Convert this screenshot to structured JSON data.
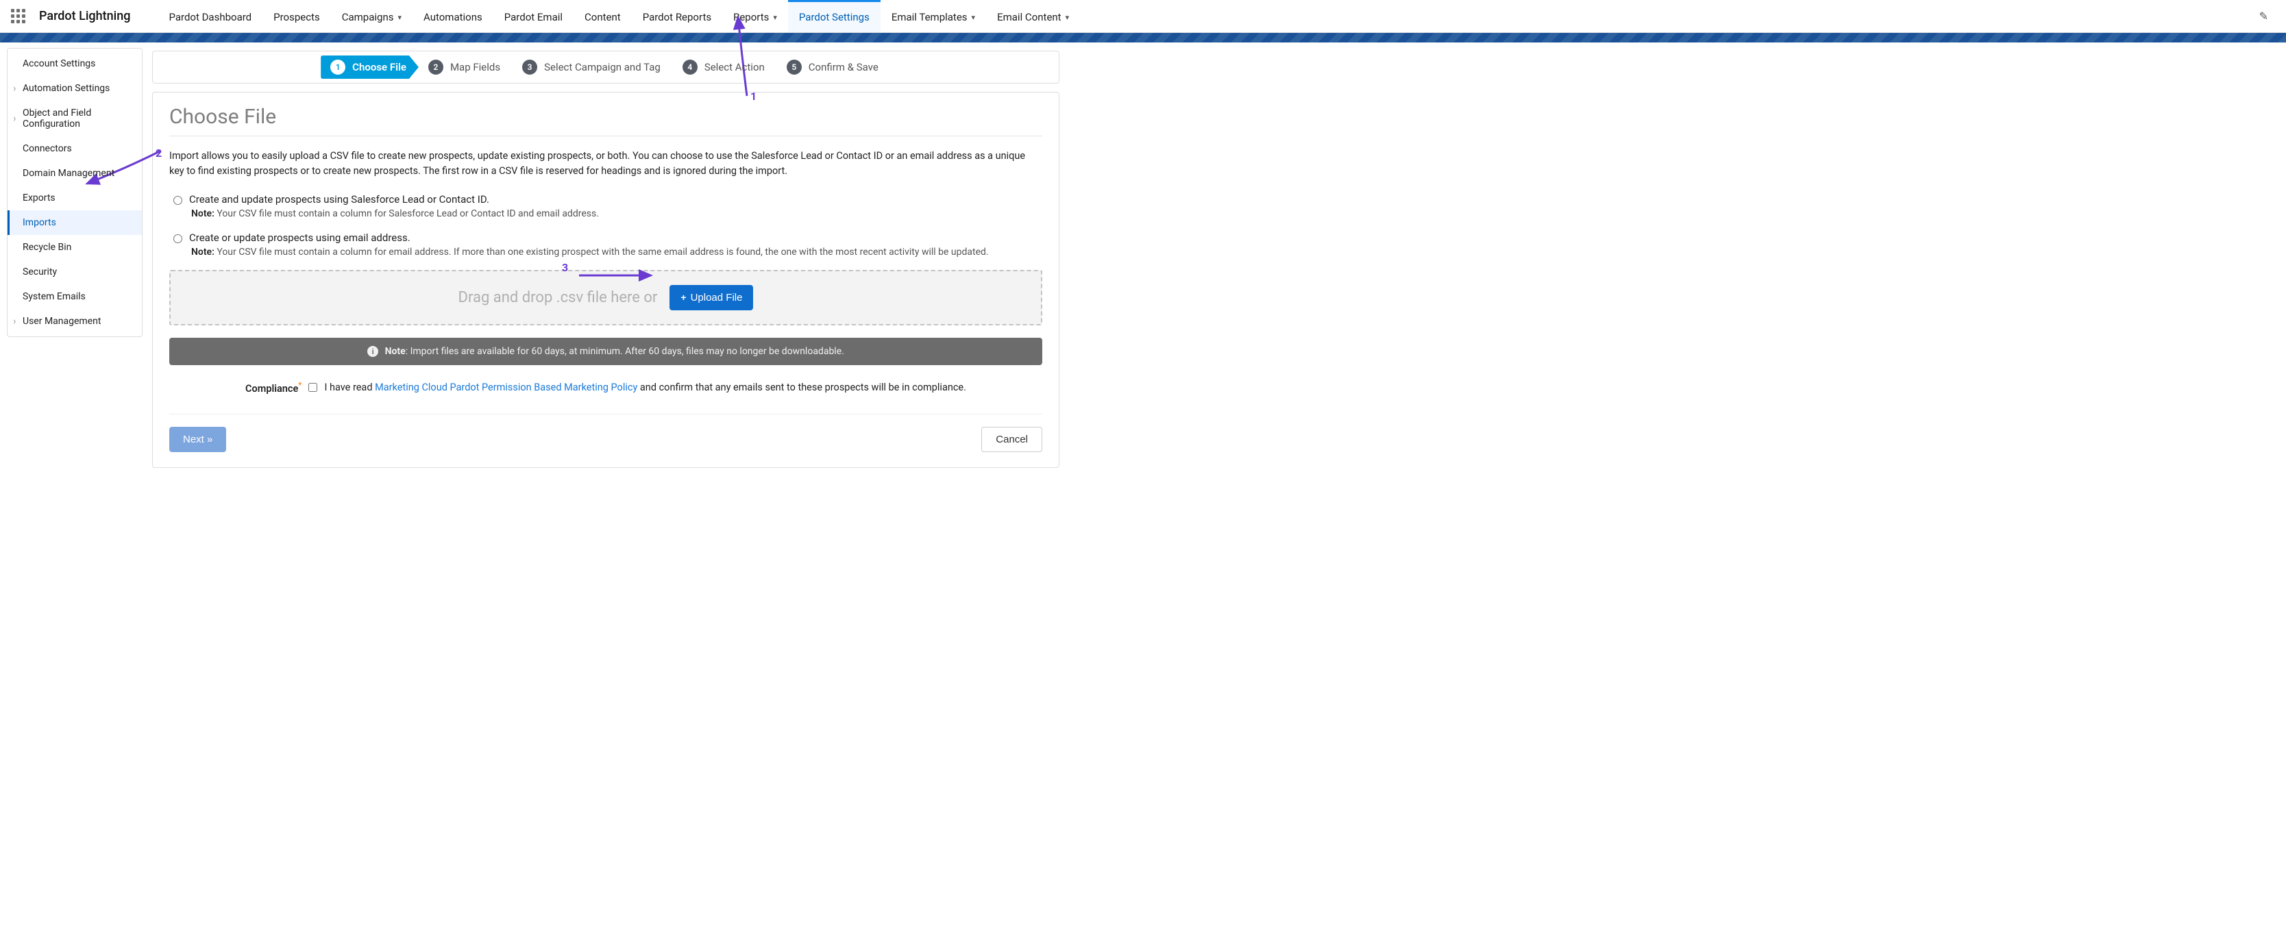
{
  "app_title": "Pardot Lightning",
  "top_tabs": [
    {
      "label": "Pardot Dashboard",
      "chev": false
    },
    {
      "label": "Prospects",
      "chev": false
    },
    {
      "label": "Campaigns",
      "chev": true
    },
    {
      "label": "Automations",
      "chev": false
    },
    {
      "label": "Pardot Email",
      "chev": false
    },
    {
      "label": "Content",
      "chev": false
    },
    {
      "label": "Pardot Reports",
      "chev": false
    },
    {
      "label": "Reports",
      "chev": true
    },
    {
      "label": "Pardot Settings",
      "chev": false,
      "active": true
    },
    {
      "label": "Email Templates",
      "chev": true
    },
    {
      "label": "Email Content",
      "chev": true
    }
  ],
  "sidebar": {
    "items": [
      {
        "label": "Account Settings",
        "caret": false
      },
      {
        "label": "Automation Settings",
        "caret": true
      },
      {
        "label": "Object and Field Configuration",
        "caret": true
      },
      {
        "label": "Connectors",
        "caret": false
      },
      {
        "label": "Domain Management",
        "caret": false
      },
      {
        "label": "Exports",
        "caret": false
      },
      {
        "label": "Imports",
        "caret": false,
        "active": true
      },
      {
        "label": "Recycle Bin",
        "caret": false
      },
      {
        "label": "Security",
        "caret": false
      },
      {
        "label": "System Emails",
        "caret": false
      },
      {
        "label": "User Management",
        "caret": true
      }
    ]
  },
  "wizard_steps": [
    {
      "n": "1",
      "label": "Choose File",
      "active": true
    },
    {
      "n": "2",
      "label": "Map Fields"
    },
    {
      "n": "3",
      "label": "Select Campaign and Tag"
    },
    {
      "n": "4",
      "label": "Select Action"
    },
    {
      "n": "5",
      "label": "Confirm & Save"
    }
  ],
  "page": {
    "heading": "Choose File",
    "intro": "Import allows you to easily upload a CSV file to create new prospects, update existing prospects, or both. You can choose to use the Salesforce Lead or Contact ID or an email address as a unique key to find existing prospects or to create new prospects. The first row in a CSV file is reserved for headings and is ignored during the import.",
    "option1": {
      "label": "Create and update prospects using Salesforce Lead or Contact ID.",
      "note_prefix": "Note:",
      "note_text": " Your CSV file must contain a column for Salesforce Lead or Contact ID and email address."
    },
    "option2": {
      "label": "Create or update prospects using email address.",
      "note_prefix": "Note:",
      "note_text": " Your CSV file must contain a column for email address. If more than one existing prospect with the same email address is found, the one with the most recent activity will be updated."
    },
    "dropzone_text": "Drag and drop .csv file here or",
    "upload_btn": "Upload File",
    "notebar_prefix": "Note",
    "notebar_text": ": Import files are available for 60 days, at minimum. After 60 days, files may no longer be downloadable.",
    "compliance_label": "Compliance",
    "compliance_before": "I have read ",
    "compliance_link": "Marketing Cloud Pardot Permission Based Marketing Policy",
    "compliance_after": " and confirm that any emails sent to these prospects will be in compliance.",
    "next_btn": "Next »",
    "cancel_btn": "Cancel"
  },
  "annotations": {
    "a1": "1",
    "a2": "2",
    "a3": "3"
  }
}
